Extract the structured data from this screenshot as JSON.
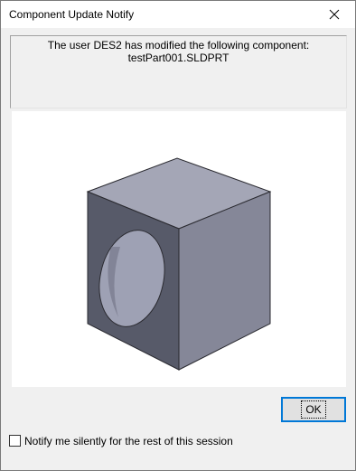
{
  "window": {
    "title": "Component Update Notify"
  },
  "message": {
    "line1": "The user DES2 has modified the following component:",
    "line2": "testPart001.SLDPRT"
  },
  "preview": {
    "icon": "part-preview-cube",
    "colors": {
      "top": "#a4a6b6",
      "right": "#858798",
      "left": "#575a69",
      "hole": "#9ea1b4"
    }
  },
  "buttons": {
    "ok_label": "OK"
  },
  "notify": {
    "checked": false,
    "label": "Notify me silently for the rest of this session"
  },
  "theme": {
    "accent": "#0078d7"
  }
}
